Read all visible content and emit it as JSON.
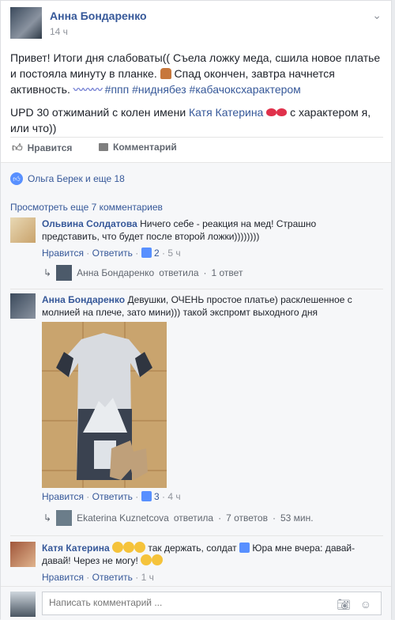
{
  "post": {
    "author": "Анна Бондаренко",
    "time": "14 ч",
    "text_line1": "Привет! Итоги дня слабоваты(( Съела ложку меда, сшила новое платье и постояла минуту в планке.",
    "text_line2": "Спад окончен, завтра начнется активность.",
    "wave": "〰〰〰",
    "hashtags": "#ппп #ниднябез #кабачоксхарактером",
    "upd_prefix": "UPD 30 отжиманий с колен имени",
    "upd_mention": "Катя Катерина",
    "upd_suffix": "с характером я, или что))"
  },
  "actions": {
    "like": "Нравится",
    "comment": "Комментарий"
  },
  "likes": {
    "text": "Ольга Берек и еще 18"
  },
  "comments": {
    "view_more": "Просмотреть еще 7 комментариев",
    "items": [
      {
        "author": "Ольвина Солдатова",
        "text": "Ничего себе - реакция на мед! Страшно представить, что будет после второй ложки))))))))",
        "like": "Нравится",
        "reply": "Ответить",
        "likes_count": "2",
        "time": "5 ч",
        "reply_summary": {
          "author": "Анна Бондаренко",
          "verb": "ответила",
          "count": "1 ответ"
        }
      },
      {
        "author": "Анна Бондаренко",
        "text": "Девушки, ОЧЕНЬ простое платье) расклешенное с молнией на плече, зато мини))) такой экспромт выходного дня",
        "like": "Нравится",
        "reply": "Ответить",
        "likes_count": "3",
        "time": "4 ч",
        "reply_summary": {
          "author": "Ekaterina Kuznetcova",
          "verb": "ответила",
          "count": "7 ответов",
          "time": "53 мин."
        }
      },
      {
        "author": "Катя Катерина",
        "text_a": "так держать, солдат",
        "text_b": "Юра мне вчера: давай-давай! Через не могу!",
        "like": "Нравится",
        "reply": "Ответить",
        "time": "1 ч"
      }
    ]
  },
  "composer": {
    "placeholder": "Написать комментарий ..."
  },
  "colors": {
    "link": "#365899",
    "like_blue": "#5890ff",
    "meta": "#90949c"
  },
  "dot": "·"
}
